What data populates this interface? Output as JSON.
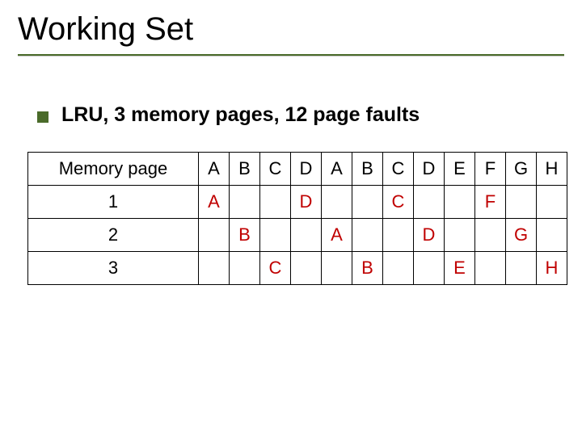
{
  "title": "Working Set",
  "bullet": "LRU, 3 memory pages, 12 page faults",
  "table": {
    "row_label_header": "Memory page",
    "headers": [
      "A",
      "B",
      "C",
      "D",
      "A",
      "B",
      "C",
      "D",
      "E",
      "F",
      "G",
      "H"
    ],
    "rows": [
      {
        "label": "1",
        "cells": [
          {
            "t": "A",
            "c": "red"
          },
          {
            "t": ""
          },
          {
            "t": ""
          },
          {
            "t": "D",
            "c": "red"
          },
          {
            "t": ""
          },
          {
            "t": ""
          },
          {
            "t": "C",
            "c": "red"
          },
          {
            "t": ""
          },
          {
            "t": ""
          },
          {
            "t": "F",
            "c": "red"
          },
          {
            "t": ""
          },
          {
            "t": ""
          }
        ]
      },
      {
        "label": "2",
        "cells": [
          {
            "t": ""
          },
          {
            "t": "B",
            "c": "red"
          },
          {
            "t": ""
          },
          {
            "t": ""
          },
          {
            "t": "A",
            "c": "red"
          },
          {
            "t": ""
          },
          {
            "t": ""
          },
          {
            "t": "D",
            "c": "red"
          },
          {
            "t": ""
          },
          {
            "t": ""
          },
          {
            "t": "G",
            "c": "red"
          },
          {
            "t": ""
          }
        ]
      },
      {
        "label": "3",
        "cells": [
          {
            "t": ""
          },
          {
            "t": ""
          },
          {
            "t": "C",
            "c": "red"
          },
          {
            "t": ""
          },
          {
            "t": ""
          },
          {
            "t": "B",
            "c": "red"
          },
          {
            "t": ""
          },
          {
            "t": ""
          },
          {
            "t": "E",
            "c": "red"
          },
          {
            "t": ""
          },
          {
            "t": ""
          },
          {
            "t": "H",
            "c": "red"
          }
        ]
      }
    ]
  }
}
